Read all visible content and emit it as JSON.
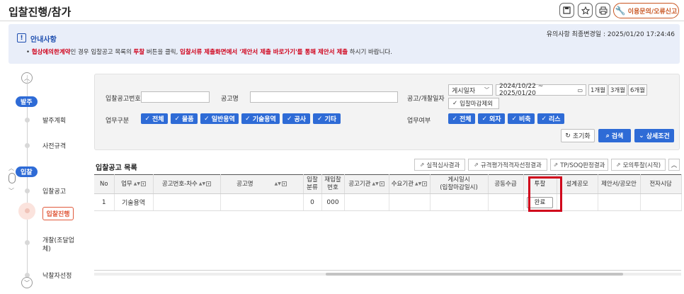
{
  "page": {
    "title": "입찰진행/참가"
  },
  "toolbar": {
    "print_icon": "printer-icon",
    "favorite_icon": "star-icon",
    "save_icon": "save-icon",
    "report_label": "이용문의/오류신고",
    "report_icon": "wrench-icon"
  },
  "notice": {
    "title": "안내사항",
    "date_text": "유의사항 최종변경일 : 2025/01/20 17:24:46",
    "text_red1": "협상에의한계약",
    "text_mid1": "인 경우 입찰공고 목록의 ",
    "text_red2": "투찰",
    "text_mid2": " 버튼을 클릭, ",
    "text_red3": "입찰서류 제출화면에서 '제안서 제출 바로가기'를 통해 제안서 제출",
    "text_end": " 하시기 바랍니다."
  },
  "stepper": {
    "group1": "발주",
    "step1": "발주계획",
    "step2": "사전규격",
    "group2": "입찰",
    "step3": "입찰공고",
    "step4": "입찰진행",
    "step5": "개찰(조달업체)",
    "step6": "낙찰자선정"
  },
  "search": {
    "notice_no_label": "입찰공고번호",
    "notice_no_value": "",
    "notice_name_label": "공고명",
    "notice_name_value": "",
    "date_label": "공고/개찰일자",
    "date_type": "게시일자",
    "date_range": "2024/10/22  ~  2025/01/20",
    "period1": "1개월",
    "period2": "3개월",
    "period3": "6개월",
    "exclude_closed": "입찰마감제외",
    "work_type_label": "업무구분",
    "work_types": [
      "전체",
      "물품",
      "일반용역",
      "기술용역",
      "공사",
      "기타"
    ],
    "work_status_label": "업무여부",
    "work_statuses": [
      "전체",
      "외자",
      "비축",
      "리스"
    ],
    "reset_label": "초기화",
    "search_label": "검색",
    "detail_label": "상세조건"
  },
  "list": {
    "title": "입찰공고 목록",
    "buttons": [
      "실적심사결과",
      "규격평가적격자선정결과",
      "TP/SOQ판정결과",
      "모의투찰(시작)"
    ],
    "columns": [
      "No",
      "업무",
      "공고번호-차수",
      "공고명",
      "입찰\n분류",
      "재입찰\n번호",
      "공고기관",
      "수요기관",
      "게시일시\n(입찰마감일시)",
      "공동수급",
      "투찰",
      "설계공모",
      "제안서/공모안",
      "전자시담"
    ],
    "rows": [
      {
        "no": "1",
        "work": "기술용역",
        "notice_no": "",
        "notice_name": "",
        "bid_class": "0",
        "rebid_no": "000",
        "org": "",
        "demand_org": "",
        "posted": "",
        "joint": "",
        "bid_button": "완료",
        "design": "",
        "proposal": "",
        "e_negotiation": ""
      }
    ]
  },
  "colors": {
    "accent": "#2e6bd6",
    "highlight": "#d0021b",
    "active_step": "#e05a3c"
  }
}
